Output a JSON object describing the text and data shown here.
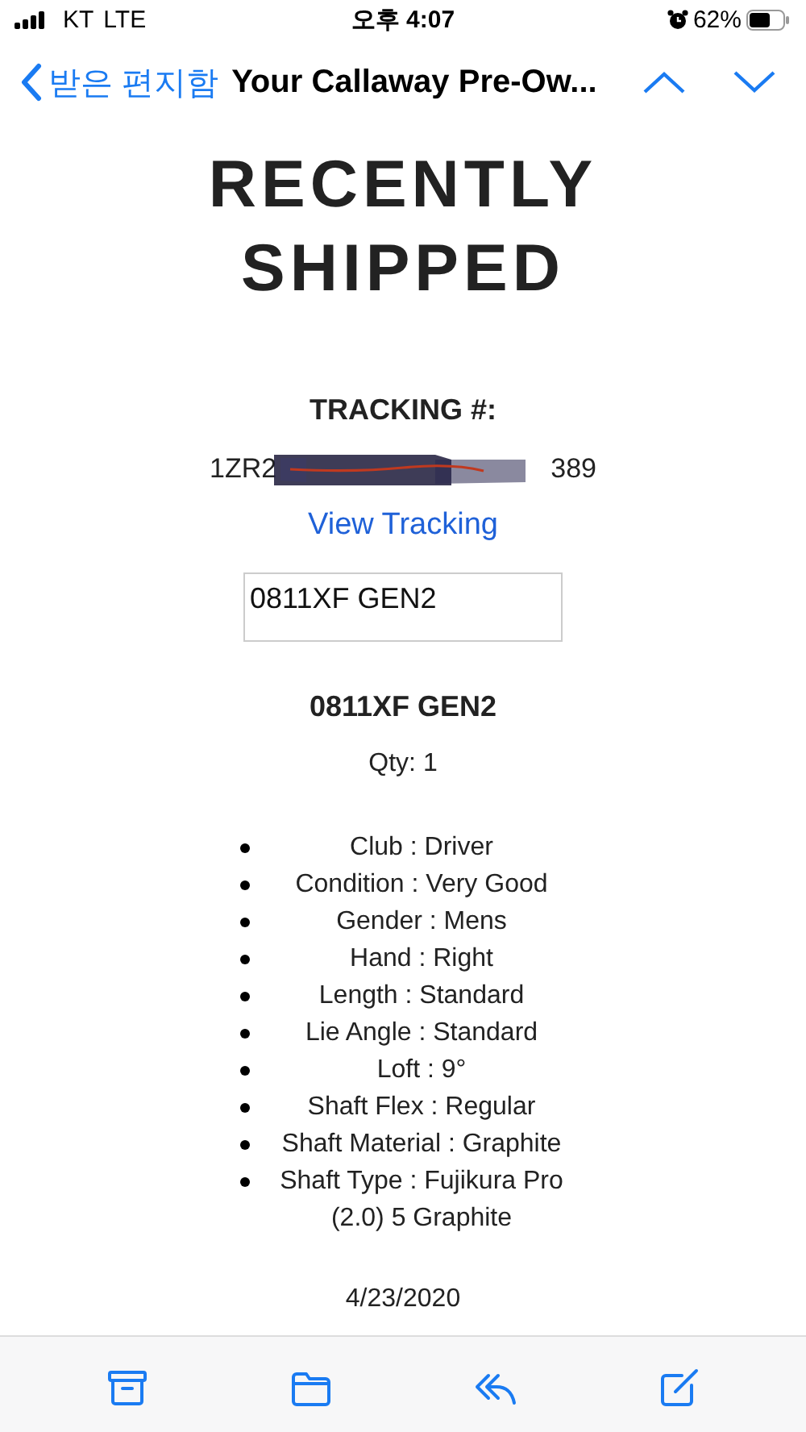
{
  "status_bar": {
    "carrier": "KT",
    "network": "LTE",
    "time": "오후 4:07",
    "battery": "62%"
  },
  "nav": {
    "back_label": "받은 편지함",
    "subject": "Your Callaway Pre-Ow..."
  },
  "email": {
    "heading_lines": [
      "RECENTLY",
      "SHIPPED"
    ],
    "tracking_label": "TRACKING #:",
    "tracking_visible_start": "1ZR2",
    "tracking_visible_end": "389",
    "tracking_link": "View Tracking",
    "image_alt": "0811XF GEN2",
    "product_name": "0811XF GEN2",
    "quantity": "Qty: 1",
    "specs": [
      "Club : Driver",
      "Condition : Very Good",
      "Gender : Mens",
      "Hand : Right",
      "Length : Standard",
      "Lie Angle : Standard",
      "Loft : 9°",
      "Shaft Flex : Regular",
      "Shaft Material : Graphite",
      "Shaft Type : Fujikura Pro (2.0) 5 Graphite"
    ],
    "date": "4/23/2020"
  },
  "toolbar": [
    {
      "kind": "archive"
    },
    {
      "kind": "folder"
    },
    {
      "kind": "reply"
    },
    {
      "kind": "compose"
    }
  ]
}
